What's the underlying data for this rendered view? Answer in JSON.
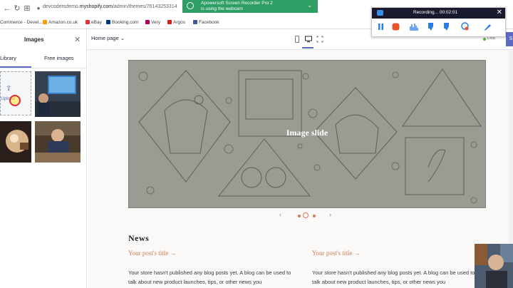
{
  "browser": {
    "url_prefix": "devcodersdemo.",
    "url_domain": "myshopify.com",
    "url_path": "/admin/themes/76143253314",
    "bookmarks": [
      {
        "label": "Commerce - Devel...",
        "color": "#3b5998"
      },
      {
        "label": "Amazon.co.uk",
        "color": "#ff9900"
      },
      {
        "label": "eBay",
        "color": "#e53238"
      },
      {
        "label": "Booking.com",
        "color": "#003580"
      },
      {
        "label": "Very",
        "color": "#b0005b"
      },
      {
        "label": "Argos",
        "color": "#d42114"
      },
      {
        "label": "Facebook",
        "color": "#3b5998"
      }
    ]
  },
  "notification": {
    "line1": "Apowersoft Screen Recorder Pro 2",
    "line2": "is using the webcam",
    "color": "#2e9e64"
  },
  "recorder": {
    "title": "Recording... 00:02:01",
    "tools": [
      "pause-icon",
      "stop-icon",
      "waveform-icon",
      "pen-icon",
      "marker-icon",
      "webcam-icon",
      "brush-icon"
    ]
  },
  "sidebar": {
    "title": "Images",
    "tabs": [
      "Library",
      "Free images"
    ],
    "upload_label": "Upload"
  },
  "topbar": {
    "page_select": "Home page",
    "live_label": "Live",
    "save_label": "S"
  },
  "preview": {
    "slide_text": "Image slide",
    "news_heading": "News",
    "posts": [
      {
        "title": "Your post's title →",
        "body": "Your store hasn't published any blog posts yet. A blog can be used to talk about new product launches, tips, or other news you"
      },
      {
        "title": "Your post's title →",
        "body": "Your store hasn't published any blog posts yet. A blog can be used to talk about new product launches, tips, or other news you"
      }
    ]
  },
  "colors": {
    "accent": "#5c6ac4",
    "link": "#d27a55",
    "slide_bg": "#9a9b93"
  }
}
